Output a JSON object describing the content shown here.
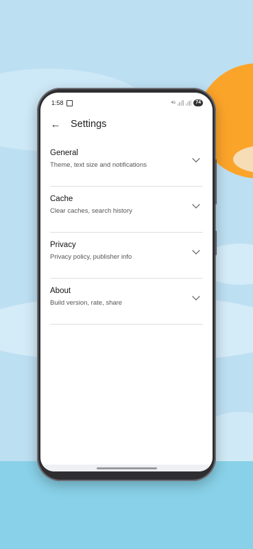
{
  "status_bar": {
    "time": "1:58",
    "network_label": "4G",
    "battery": "74"
  },
  "header": {
    "back_icon": "arrow-left-icon",
    "title": "Settings"
  },
  "settings": [
    {
      "title": "General",
      "subtitle": "Theme, text size and notifications"
    },
    {
      "title": "Cache",
      "subtitle": "Clear caches, search history"
    },
    {
      "title": "Privacy",
      "subtitle": "Privacy policy, publisher info"
    },
    {
      "title": "About",
      "subtitle": "Build version, rate, share"
    }
  ],
  "colors": {
    "background_sky": "#bddff2",
    "sun": "#fba42a",
    "sea": "#88d1e8",
    "phone_frame": "#2e2e31",
    "screen": "#ffffff"
  }
}
